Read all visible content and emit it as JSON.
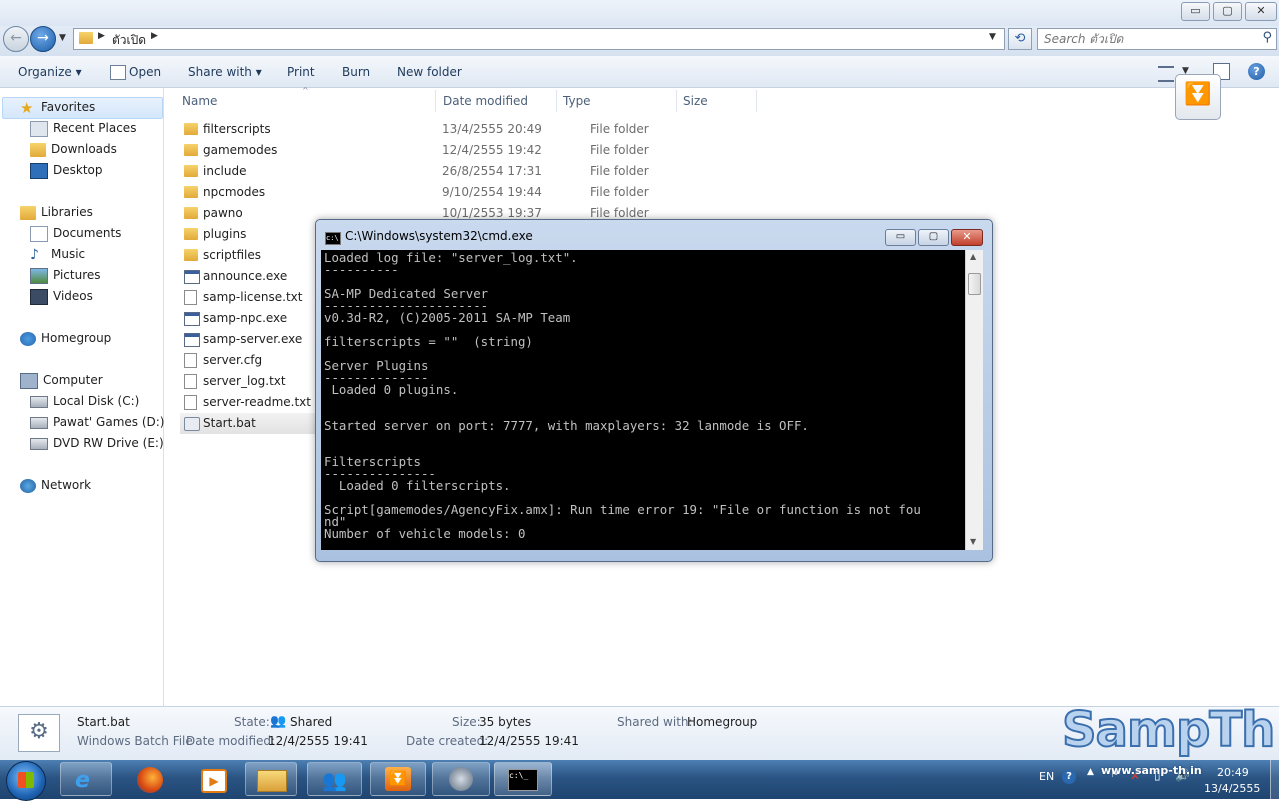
{
  "window": {
    "minimize": "▭",
    "maximize": "▢",
    "close": "✕"
  },
  "address": {
    "path": "ตัวเปิด",
    "search_placeholder": "Search ตัวเปิด"
  },
  "toolbar": {
    "organize": "Organize ▾",
    "open": "Open",
    "share_with": "Share with ▾",
    "print": "Print",
    "burn": "Burn",
    "new_folder": "New folder"
  },
  "nav": {
    "favorites": "Favorites",
    "recent_places": "Recent Places",
    "downloads": "Downloads",
    "desktop": "Desktop",
    "libraries": "Libraries",
    "documents": "Documents",
    "music": "Music",
    "pictures": "Pictures",
    "videos": "Videos",
    "homegroup": "Homegroup",
    "computer": "Computer",
    "local_disk": "Local Disk (C:)",
    "games_disk": "Pawat' Games (D:)",
    "dvd_drive": "DVD RW Drive (E:) GT",
    "network": "Network"
  },
  "columns": {
    "name": "Name",
    "date": "Date modified",
    "type": "Type",
    "size": "Size"
  },
  "files": [
    {
      "name": "filterscripts",
      "date": "13/4/2555 20:49",
      "type": "File folder",
      "kind": "folder"
    },
    {
      "name": "gamemodes",
      "date": "12/4/2555 19:42",
      "type": "File folder",
      "kind": "folder"
    },
    {
      "name": "include",
      "date": "26/8/2554 17:31",
      "type": "File folder",
      "kind": "folder"
    },
    {
      "name": "npcmodes",
      "date": "9/10/2554 19:44",
      "type": "File folder",
      "kind": "folder"
    },
    {
      "name": "pawno",
      "date": "10/1/2553 19:37",
      "type": "File folder",
      "kind": "folder"
    },
    {
      "name": "plugins",
      "date": "",
      "type": "",
      "kind": "folder"
    },
    {
      "name": "scriptfiles",
      "date": "",
      "type": "",
      "kind": "folder"
    },
    {
      "name": "announce.exe",
      "date": "",
      "type": "",
      "kind": "exe"
    },
    {
      "name": "samp-license.txt",
      "date": "",
      "type": "",
      "kind": "file"
    },
    {
      "name": "samp-npc.exe",
      "date": "",
      "type": "",
      "kind": "exe"
    },
    {
      "name": "samp-server.exe",
      "date": "",
      "type": "",
      "kind": "exe"
    },
    {
      "name": "server.cfg",
      "date": "",
      "type": "",
      "kind": "cfg"
    },
    {
      "name": "server_log.txt",
      "date": "",
      "type": "",
      "kind": "file"
    },
    {
      "name": "server-readme.txt",
      "date": "",
      "type": "",
      "kind": "file"
    },
    {
      "name": "Start.bat",
      "date": "",
      "type": "",
      "kind": "bat"
    }
  ],
  "cmd": {
    "title": "C:\\Windows\\system32\\cmd.exe",
    "lines": [
      "Loaded log file: \"server_log.txt\".",
      "----------",
      "",
      "SA-MP Dedicated Server",
      "----------------------",
      "v0.3d-R2, (C)2005-2011 SA-MP Team",
      "",
      "filterscripts = \"\"  (string)",
      "",
      "Server Plugins",
      "--------------",
      " Loaded 0 plugins.",
      "",
      "",
      "Started server on port: 7777, with maxplayers: 32 lanmode is OFF.",
      "",
      "",
      "Filterscripts",
      "---------------",
      "  Loaded 0 filterscripts.",
      "",
      "Script[gamemodes/AgencyFix.amx]: Run time error 19: \"File or function is not fou",
      "nd\"",
      "Number of vehicle models: 0"
    ]
  },
  "details": {
    "filename": "Start.bat",
    "filetype": "Windows Batch File",
    "state_label": "State:",
    "state_value": "Shared",
    "size_label": "Size:",
    "size_value": "35 bytes",
    "shared_label": "Shared with:",
    "shared_value": "Homegroup",
    "modified_label": "Date modified:",
    "modified_value": "12/4/2555 19:41",
    "created_label": "Date created:",
    "created_value": "12/4/2555 19:41"
  },
  "taskbar": {
    "lang": "EN",
    "time": "20:49",
    "date": "13/4/2555"
  },
  "watermark": {
    "brand": "SampTh",
    "url": "www.samp-th.in"
  }
}
